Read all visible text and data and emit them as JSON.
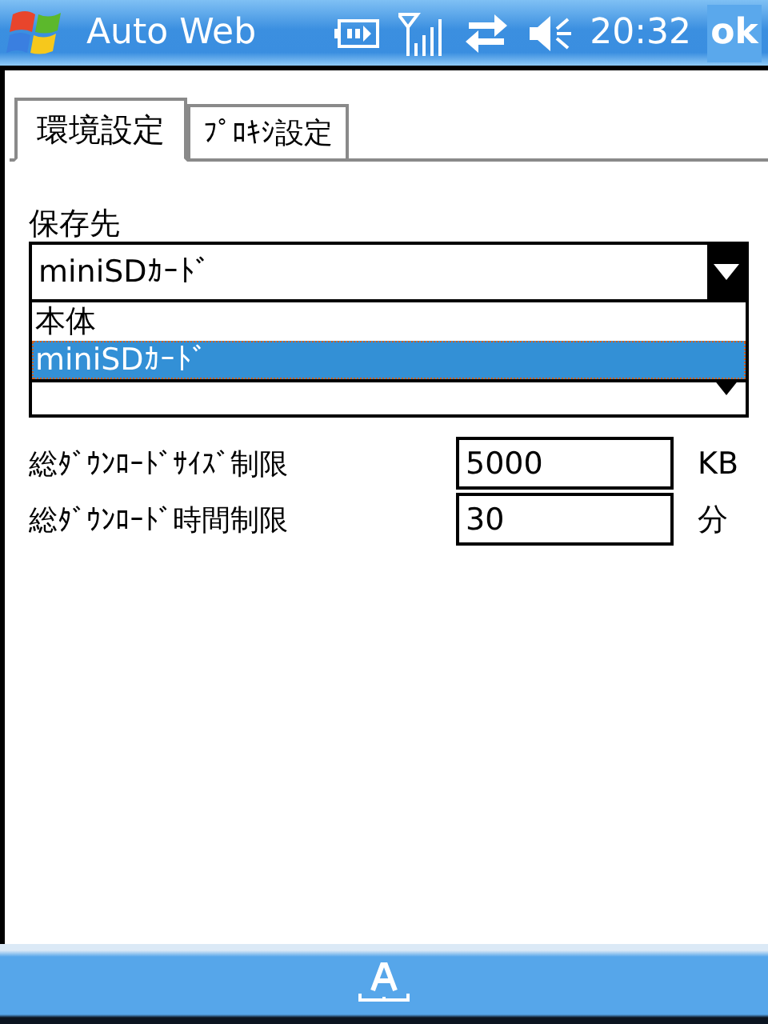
{
  "title_bar": {
    "title": "Auto Web",
    "time": "20:32",
    "ok_button": "ok"
  },
  "tabs": [
    {
      "label": "環境設定",
      "selected": true
    },
    {
      "label": "ﾌﾟﾛｷｼ設定",
      "selected": false
    }
  ],
  "save_location": {
    "label": "保存先",
    "value": "miniSDｶｰﾄﾞ",
    "options": [
      {
        "label": "本体",
        "selected": false
      },
      {
        "label": "miniSDｶｰﾄﾞ",
        "selected": true
      }
    ]
  },
  "limits": [
    {
      "label": "総ﾀﾞｳﾝﾛｰﾄﾞｻｲｽﾞ制限",
      "value": "5000",
      "unit": "KB"
    },
    {
      "label": "総ﾀﾞｳﾝﾛｰﾄﾞ時間制限",
      "value": "30",
      "unit": "分"
    }
  ]
}
